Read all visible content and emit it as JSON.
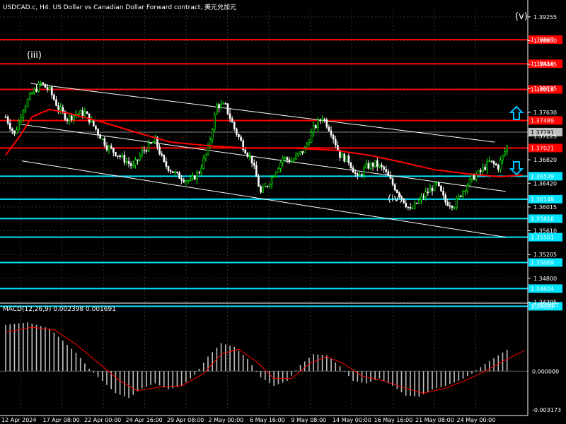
{
  "header": {
    "title": "USDCAD.c, H4:  US Dollar vs Canadian Dollar Forward contract, 美元兑加元",
    "macd_title": "MACD(12,26,9) 0.002398 0.001691"
  },
  "colors": {
    "background": "#000000",
    "grid": "#333333",
    "bull": "#00ff00",
    "bear": "#ffffff",
    "ma": "#ff0000",
    "resistance": "#ff0000",
    "support": "#00e5ff",
    "channel": "#ffffff",
    "macd_hist": "#c0c0c0",
    "macd_signal": "#ff0000",
    "arrows": "#00bfff"
  },
  "waves": [
    {
      "label": "(iii)",
      "x": "17 Apr 00:00",
      "y": 1.3812
    },
    {
      "label": "(iv)",
      "x": "15 May 00:00",
      "y": 1.3587
    },
    {
      "label": "(v)",
      "x": "24 May 16:00",
      "y": 1.3905
    }
  ],
  "chart_data": [
    {
      "type": "candlestick",
      "symbol": "USDCAD.c",
      "timeframe": "H4",
      "ylim": [
        1.344,
        1.3935
      ],
      "price_ticks": [
        "1.39255",
        "1.38850",
        "1.38445",
        "1.38035",
        "1.37630",
        "1.37225",
        "1.36820",
        "1.36420",
        "1.36015",
        "1.35610",
        "1.35205",
        "1.34800",
        "1.34395"
      ],
      "time_ticks": [
        "12 Apr 2024",
        "17 Apr 08:00",
        "22 Apr 00:00",
        "24 Apr 16:00",
        "29 Apr 08:00",
        "2 May 00:00",
        "6 May 16:00",
        "9 May 08:00",
        "14 May 00:00",
        "16 May 16:00",
        "21 May 08:00",
        "24 May 00:00"
      ],
      "current_price": "1.37291",
      "resistance_levels": [
        "1.38867",
        "1.38456",
        "1.38018",
        "1.37489",
        "1.37021"
      ],
      "support_levels": [
        "1.36539",
        "1.36148",
        "1.35816",
        "1.35501",
        "1.35069",
        "1.34624",
        "1.34323"
      ],
      "moving_average": [
        {
          "t": 0,
          "v": 1.369
        },
        {
          "t": 6,
          "v": 1.372
        },
        {
          "t": 12,
          "v": 1.3755
        },
        {
          "t": 20,
          "v": 1.3768
        },
        {
          "t": 30,
          "v": 1.376
        },
        {
          "t": 45,
          "v": 1.3745
        },
        {
          "t": 60,
          "v": 1.3728
        },
        {
          "t": 75,
          "v": 1.3712
        },
        {
          "t": 95,
          "v": 1.3705
        },
        {
          "t": 110,
          "v": 1.3702
        },
        {
          "t": 130,
          "v": 1.3702
        },
        {
          "t": 150,
          "v": 1.3698
        },
        {
          "t": 165,
          "v": 1.369
        },
        {
          "t": 180,
          "v": 1.3678
        },
        {
          "t": 195,
          "v": 1.3665
        },
        {
          "t": 210,
          "v": 1.3658
        },
        {
          "t": 225,
          "v": 1.3653
        },
        {
          "t": 235,
          "v": 1.3656
        }
      ],
      "channel_lines": [
        {
          "from": {
            "t": 14,
            "v": 1.3812
          },
          "to": {
            "t": 225,
            "v": 1.3712
          }
        },
        {
          "from": {
            "t": 10,
            "v": 1.3742
          },
          "to": {
            "t": 230,
            "v": 1.3628
          }
        },
        {
          "from": {
            "t": 10,
            "v": 1.368
          },
          "to": {
            "t": 230,
            "v": 1.355
          }
        }
      ],
      "price_path": [
        {
          "t": 0,
          "v": 1.3755
        },
        {
          "t": 4,
          "v": 1.3725
        },
        {
          "t": 8,
          "v": 1.377
        },
        {
          "t": 12,
          "v": 1.3795
        },
        {
          "t": 16,
          "v": 1.3812
        },
        {
          "t": 20,
          "v": 1.38
        },
        {
          "t": 24,
          "v": 1.377
        },
        {
          "t": 28,
          "v": 1.3752
        },
        {
          "t": 32,
          "v": 1.376
        },
        {
          "t": 36,
          "v": 1.3762
        },
        {
          "t": 40,
          "v": 1.374
        },
        {
          "t": 46,
          "v": 1.3705
        },
        {
          "t": 52,
          "v": 1.3688
        },
        {
          "t": 58,
          "v": 1.367
        },
        {
          "t": 62,
          "v": 1.3695
        },
        {
          "t": 68,
          "v": 1.3715
        },
        {
          "t": 72,
          "v": 1.3675
        },
        {
          "t": 78,
          "v": 1.3655
        },
        {
          "t": 84,
          "v": 1.3645
        },
        {
          "t": 88,
          "v": 1.3662
        },
        {
          "t": 92,
          "v": 1.37
        },
        {
          "t": 96,
          "v": 1.3775
        },
        {
          "t": 100,
          "v": 1.3773
        },
        {
          "t": 104,
          "v": 1.3735
        },
        {
          "t": 108,
          "v": 1.3705
        },
        {
          "t": 112,
          "v": 1.368
        },
        {
          "t": 116,
          "v": 1.3625
        },
        {
          "t": 120,
          "v": 1.3645
        },
        {
          "t": 126,
          "v": 1.3685
        },
        {
          "t": 130,
          "v": 1.368
        },
        {
          "t": 136,
          "v": 1.37
        },
        {
          "t": 140,
          "v": 1.3735
        },
        {
          "t": 144,
          "v": 1.3755
        },
        {
          "t": 148,
          "v": 1.373
        },
        {
          "t": 152,
          "v": 1.369
        },
        {
          "t": 156,
          "v": 1.368
        },
        {
          "t": 160,
          "v": 1.365
        },
        {
          "t": 164,
          "v": 1.367
        },
        {
          "t": 168,
          "v": 1.3675
        },
        {
          "t": 172,
          "v": 1.3665
        },
        {
          "t": 176,
          "v": 1.364
        },
        {
          "t": 180,
          "v": 1.3618
        },
        {
          "t": 184,
          "v": 1.3595
        },
        {
          "t": 188,
          "v": 1.3612
        },
        {
          "t": 192,
          "v": 1.3628
        },
        {
          "t": 196,
          "v": 1.364
        },
        {
          "t": 200,
          "v": 1.361
        },
        {
          "t": 204,
          "v": 1.3605
        },
        {
          "t": 208,
          "v": 1.363
        },
        {
          "t": 212,
          "v": 1.365
        },
        {
          "t": 216,
          "v": 1.3662
        },
        {
          "t": 220,
          "v": 1.3678
        },
        {
          "t": 224,
          "v": 1.367
        },
        {
          "t": 228,
          "v": 1.3705
        },
        {
          "t": 232,
          "v": 1.373
        },
        {
          "t": 236,
          "v": 1.3729
        }
      ]
    },
    {
      "type": "bar",
      "name": "MACD(12,26,9)",
      "macd_value": "0.002398",
      "signal_value": "0.001691",
      "ylim": [
        -0.003173,
        0.005407
      ],
      "y_ticks": [
        "0.005407",
        "0.000000",
        "-0.003173"
      ],
      "histogram": [
        {
          "t": 0,
          "v": 0.0038
        },
        {
          "t": 10,
          "v": 0.004
        },
        {
          "t": 20,
          "v": 0.0035
        },
        {
          "t": 26,
          "v": 0.0025
        },
        {
          "t": 32,
          "v": 0.0015
        },
        {
          "t": 38,
          "v": 0.0002
        },
        {
          "t": 44,
          "v": -0.0008
        },
        {
          "t": 50,
          "v": -0.0018
        },
        {
          "t": 56,
          "v": -0.0022
        },
        {
          "t": 62,
          "v": -0.0014
        },
        {
          "t": 68,
          "v": -0.001
        },
        {
          "t": 74,
          "v": -0.0015
        },
        {
          "t": 80,
          "v": -0.0012
        },
        {
          "t": 86,
          "v": -0.0003
        },
        {
          "t": 92,
          "v": 0.0012
        },
        {
          "t": 98,
          "v": 0.0023
        },
        {
          "t": 104,
          "v": 0.002
        },
        {
          "t": 110,
          "v": 0.001
        },
        {
          "t": 116,
          "v": -0.0005
        },
        {
          "t": 122,
          "v": -0.0012
        },
        {
          "t": 128,
          "v": -0.0008
        },
        {
          "t": 134,
          "v": 0.0005
        },
        {
          "t": 140,
          "v": 0.0014
        },
        {
          "t": 146,
          "v": 0.0013
        },
        {
          "t": 152,
          "v": 0.0004
        },
        {
          "t": 158,
          "v": -0.0008
        },
        {
          "t": 164,
          "v": -0.001
        },
        {
          "t": 170,
          "v": -0.0006
        },
        {
          "t": 176,
          "v": -0.0012
        },
        {
          "t": 182,
          "v": -0.002
        },
        {
          "t": 188,
          "v": -0.0021
        },
        {
          "t": 194,
          "v": -0.0015
        },
        {
          "t": 200,
          "v": -0.0012
        },
        {
          "t": 206,
          "v": -0.0008
        },
        {
          "t": 212,
          "v": -0.0002
        },
        {
          "t": 218,
          "v": 0.0006
        },
        {
          "t": 224,
          "v": 0.0013
        },
        {
          "t": 230,
          "v": 0.002
        },
        {
          "t": 236,
          "v": 0.0024
        }
      ],
      "signal": [
        {
          "t": 0,
          "v": 0.0032
        },
        {
          "t": 12,
          "v": 0.0036
        },
        {
          "t": 22,
          "v": 0.0034
        },
        {
          "t": 32,
          "v": 0.0022
        },
        {
          "t": 42,
          "v": 0.0007
        },
        {
          "t": 52,
          "v": -0.0008
        },
        {
          "t": 60,
          "v": -0.0016
        },
        {
          "t": 70,
          "v": -0.0013
        },
        {
          "t": 80,
          "v": -0.0012
        },
        {
          "t": 90,
          "v": -0.0002
        },
        {
          "t": 98,
          "v": 0.0014
        },
        {
          "t": 106,
          "v": 0.0018
        },
        {
          "t": 114,
          "v": 0.0008
        },
        {
          "t": 122,
          "v": -0.0006
        },
        {
          "t": 130,
          "v": -0.0006
        },
        {
          "t": 138,
          "v": 0.0006
        },
        {
          "t": 146,
          "v": 0.0012
        },
        {
          "t": 154,
          "v": 0.0006
        },
        {
          "t": 162,
          "v": -0.0004
        },
        {
          "t": 172,
          "v": -0.0008
        },
        {
          "t": 182,
          "v": -0.0014
        },
        {
          "t": 190,
          "v": -0.0018
        },
        {
          "t": 200,
          "v": -0.0014
        },
        {
          "t": 210,
          "v": -0.0007
        },
        {
          "t": 220,
          "v": 0.0002
        },
        {
          "t": 228,
          "v": 0.001
        },
        {
          "t": 236,
          "v": 0.0017
        }
      ]
    }
  ]
}
